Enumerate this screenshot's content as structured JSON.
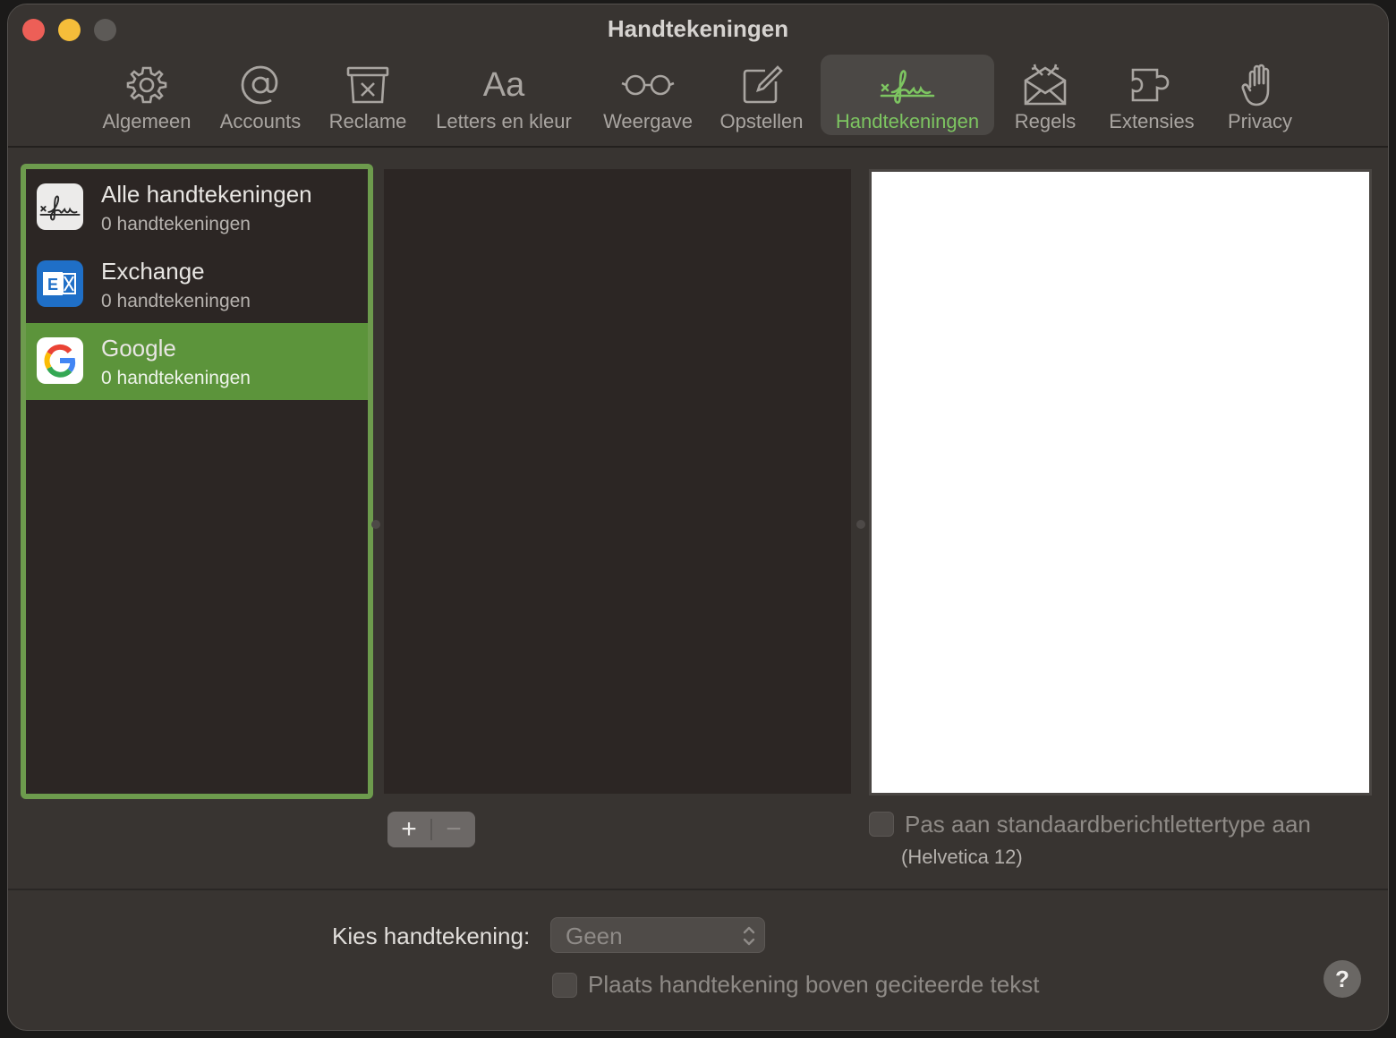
{
  "window": {
    "title": "Handtekeningen"
  },
  "toolbar": {
    "items": [
      {
        "label": "Algemeen",
        "icon": "gear-icon"
      },
      {
        "label": "Accounts",
        "icon": "at-icon"
      },
      {
        "label": "Reclame",
        "icon": "junk-bin-icon"
      },
      {
        "label": "Letters en kleur",
        "icon": "font-icon",
        "glyph": "Aa"
      },
      {
        "label": "Weergave",
        "icon": "glasses-icon"
      },
      {
        "label": "Opstellen",
        "icon": "compose-icon"
      },
      {
        "label": "Handtekeningen",
        "icon": "signature-icon",
        "active": true
      },
      {
        "label": "Regels",
        "icon": "rules-envelope-icon"
      },
      {
        "label": "Extensies",
        "icon": "puzzle-icon"
      },
      {
        "label": "Privacy",
        "icon": "hand-icon"
      }
    ],
    "active_color": "#7dc561"
  },
  "accounts": {
    "items": [
      {
        "name": "Alle handtekeningen",
        "count": "0 handtekeningen",
        "icon": "signature-icon"
      },
      {
        "name": "Exchange",
        "count": "0 handtekeningen",
        "icon": "exchange-icon"
      },
      {
        "name": "Google",
        "count": "0 handtekeningen",
        "icon": "google-icon",
        "selected": true
      }
    ],
    "selection_color": "#5c943b"
  },
  "signatures": {
    "add_label": "+",
    "remove_label": "−"
  },
  "preview": {
    "font_checkbox_label": "Pas aan standaardberichtlettertype aan",
    "font_note": "(Helvetica 12)"
  },
  "footer": {
    "choose_label": "Kies handtekening:",
    "choose_value": "Geen",
    "place_above_label": "Plaats handtekening boven geciteerde tekst",
    "help_label": "?"
  }
}
